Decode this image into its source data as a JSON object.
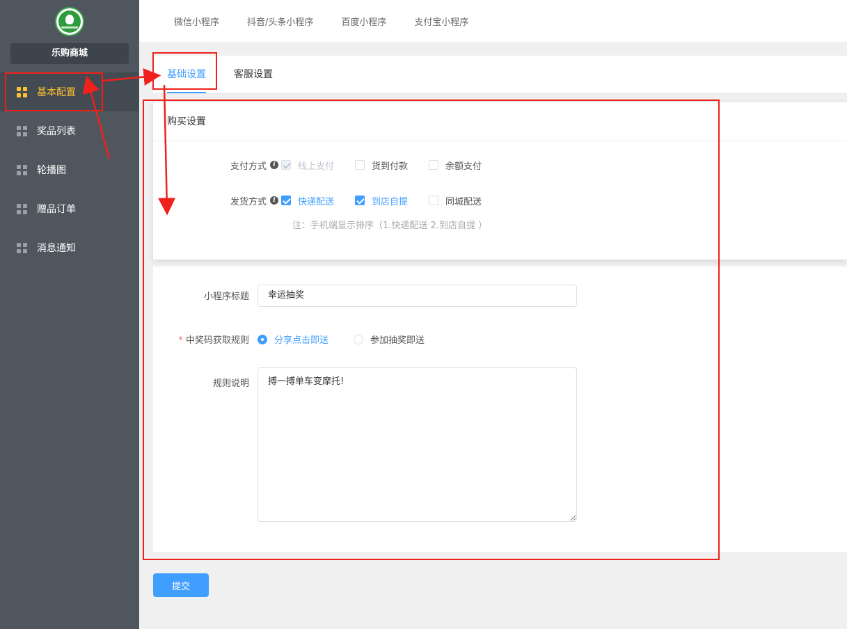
{
  "sidebar": {
    "shop_name": "乐购商城",
    "items": [
      {
        "label": "基本配置",
        "active": true
      },
      {
        "label": "奖品列表"
      },
      {
        "label": "轮播图"
      },
      {
        "label": "赠品订单"
      },
      {
        "label": "消息通知"
      }
    ]
  },
  "topnav": {
    "items": [
      "微信小程序",
      "抖音/头条小程序",
      "百度小程序",
      "支付宝小程序"
    ]
  },
  "tabs": [
    {
      "label": "基础设置",
      "active": true
    },
    {
      "label": "客服设置"
    }
  ],
  "purchase": {
    "header": "购买设置",
    "payment": {
      "label": "支付方式",
      "options": [
        {
          "label": "线上支付",
          "state": "checked-disabled"
        },
        {
          "label": "货到付款",
          "state": "unchecked"
        },
        {
          "label": "余额支付",
          "state": "unchecked"
        }
      ]
    },
    "delivery": {
      "label": "发货方式",
      "options": [
        {
          "label": "快递配送",
          "state": "checked"
        },
        {
          "label": "到店自提",
          "state": "checked"
        },
        {
          "label": "同城配送",
          "state": "unchecked"
        }
      ]
    },
    "note": "注：手机端显示排序（1.快递配送 2.到店自提 ）"
  },
  "form": {
    "title_label": "小程序标题",
    "title_value": "幸运抽奖",
    "rule_label": "中奖码获取规则",
    "rule_required_mark": "*",
    "rule_options": [
      {
        "label": "分享点击即送",
        "selected": true
      },
      {
        "label": "参加抽奖即送",
        "selected": false
      }
    ],
    "desc_label": "规则说明",
    "desc_value": "搏一搏单车变摩托!"
  },
  "submit_label": "提交",
  "colors": {
    "primary": "#409eff",
    "sidebar_bg": "#50565e",
    "active_menu": "#ffc233",
    "annotation": "#f0201c"
  }
}
